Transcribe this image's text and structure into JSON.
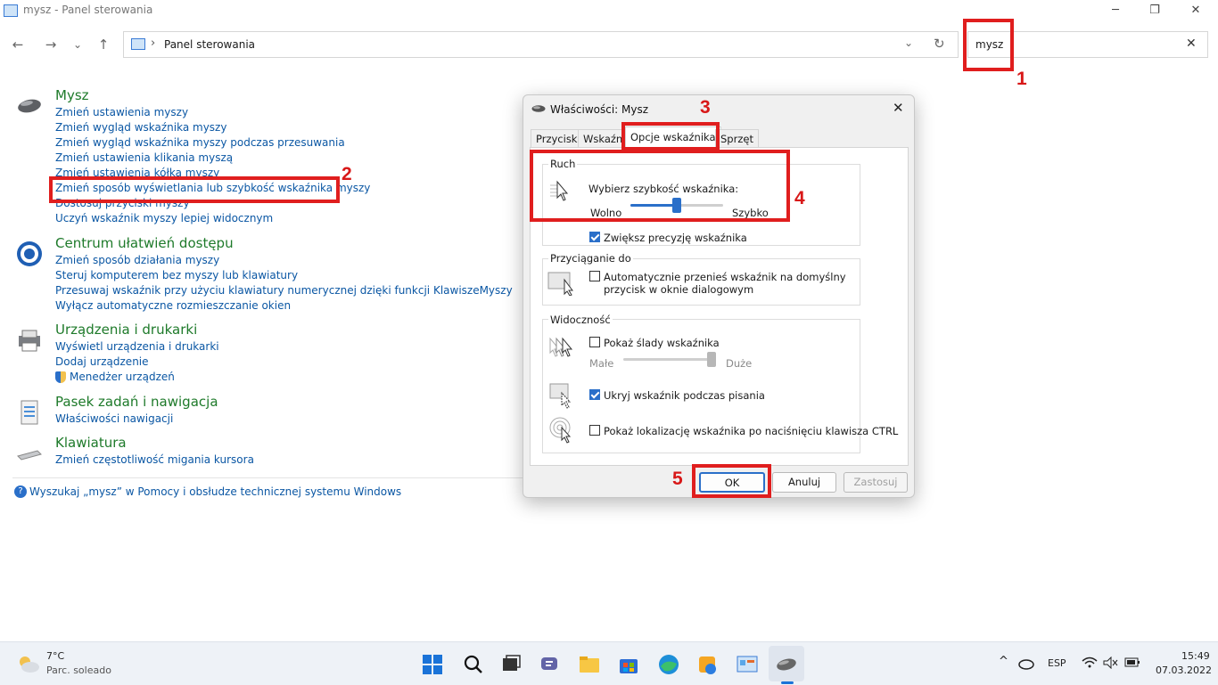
{
  "window": {
    "title": "mysz - Panel sterowania",
    "minimize": "─",
    "restore": "❐",
    "close": "✕"
  },
  "nav": {
    "back": "←",
    "forward": "→",
    "recent": "⌄",
    "up": "↑"
  },
  "address": {
    "separator": "›",
    "crumb": "Panel sterowania",
    "dropdown": "⌄",
    "refresh": "↻"
  },
  "search": {
    "value": "mysz",
    "clear": "✕"
  },
  "annotations": {
    "n1": "1",
    "n2": "2",
    "n3": "3",
    "n4": "4",
    "n5": "5",
    "color": "#e01e1e"
  },
  "results": [
    {
      "title": "Mysz",
      "icon": "mouse-icon",
      "links": [
        "Zmień ustawienia myszy",
        "Zmień wygląd wskaźnika myszy",
        "Zmień wygląd wskaźnika myszy podczas przesuwania",
        "Zmień ustawienia klikania myszą",
        "Zmień ustawienia kółka myszy",
        "Zmień sposób wyświetlania lub szybkość wskaźnika myszy",
        "Dostosuj przyciski myszy",
        "Uczyń wskaźnik myszy lepiej widocznym"
      ]
    },
    {
      "title": "Centrum ułatwień dostępu",
      "icon": "accessibility-icon",
      "links": [
        "Zmień sposób działania myszy",
        "Steruj komputerem bez myszy lub klawiatury",
        "Przesuwaj wskaźnik przy użyciu klawiatury numerycznej dzięki funkcji KlawiszeMyszy",
        "Wyłącz automatyczne rozmieszczanie okien"
      ]
    },
    {
      "title": "Urządzenia i drukarki",
      "icon": "printer-icon",
      "links": [
        "Wyświetl urządzenia i drukarki",
        "Dodaj urządzenie",
        "Menedżer urządzeń"
      ]
    },
    {
      "title": "Pasek zadań i nawigacja",
      "icon": "taskbar-icon",
      "links": [
        "Właściwości nawigacji"
      ]
    },
    {
      "title": "Klawiatura",
      "icon": "keyboard-icon",
      "links": [
        "Zmień częstotliwość migania kursora"
      ]
    }
  ],
  "help_link": "Wyszukaj „mysz” w Pomocy i obsłudze technicznej systemu Windows",
  "dialog": {
    "title": "Właściwości: Mysz",
    "close": "✕",
    "tabs": [
      "Przyciski",
      "Wskaźniki",
      "Opcje wskaźnika",
      "Sprzęt"
    ],
    "active_tab": "Opcje wskaźnika",
    "motion": {
      "group": "Ruch",
      "label": "Wybierz szybkość wskaźnika:",
      "slow": "Wolno",
      "fast": "Szybko",
      "speed_fraction": 0.5,
      "precision_label": "Zwiększ precyzję wskaźnika",
      "precision_checked": true
    },
    "snap": {
      "group": "Przyciąganie do",
      "label_line1": "Automatycznie przenieś wskaźnik na domyślny",
      "label_line2": "przycisk w oknie dialogowym",
      "checked": false
    },
    "visibility": {
      "group": "Widoczność",
      "trails_label": "Pokaż ślady wskaźnika",
      "trails_checked": false,
      "short": "Małe",
      "long": "Duże",
      "trails_fraction": 1.0,
      "hide_label": "Ukryj wskaźnik podczas pisania",
      "hide_checked": true,
      "ctrl_label": "Pokaż lokalizację wskaźnika po naciśnięciu klawisza CTRL",
      "ctrl_checked": false
    },
    "buttons": {
      "ok": "OK",
      "cancel": "Anuluj",
      "apply": "Zastosuj"
    }
  },
  "taskbar": {
    "weather_temp": "7°C",
    "weather_desc": "Parc. soleado",
    "apps": [
      "start-icon",
      "search-icon",
      "task-view-icon",
      "teams-chat-icon",
      "file-explorer-icon",
      "store-icon",
      "edge-icon",
      "photos-icon",
      "control-panel-icon",
      "mouse-icon"
    ],
    "tray_chevron": "^",
    "language": "ESP",
    "time": "15:49",
    "date": "07.03.2022"
  }
}
